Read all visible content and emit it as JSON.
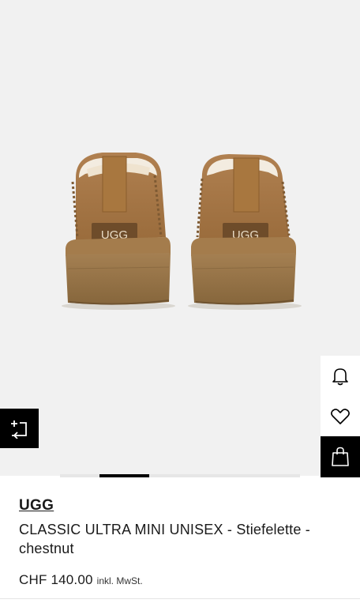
{
  "product": {
    "brand": "UGG",
    "name": "CLASSIC ULTRA MINI UNISEX - Stiefelette - chestnut",
    "price": "CHF 140.00",
    "vat_note": "inkl. MwSt.",
    "image_logo_text": "UGG",
    "color": "chestnut"
  },
  "actions": {
    "notify_icon": "bell-icon",
    "wishlist_icon": "heart-icon",
    "cart_icon": "shopping-bag-icon",
    "compare_icon": "compare-icon"
  },
  "gallery": {
    "active_index": 2
  },
  "colors": {
    "suede": "#a0733f",
    "sole": "#8c6a3f",
    "background": "#f1f1f1",
    "action_dark": "#000000"
  }
}
